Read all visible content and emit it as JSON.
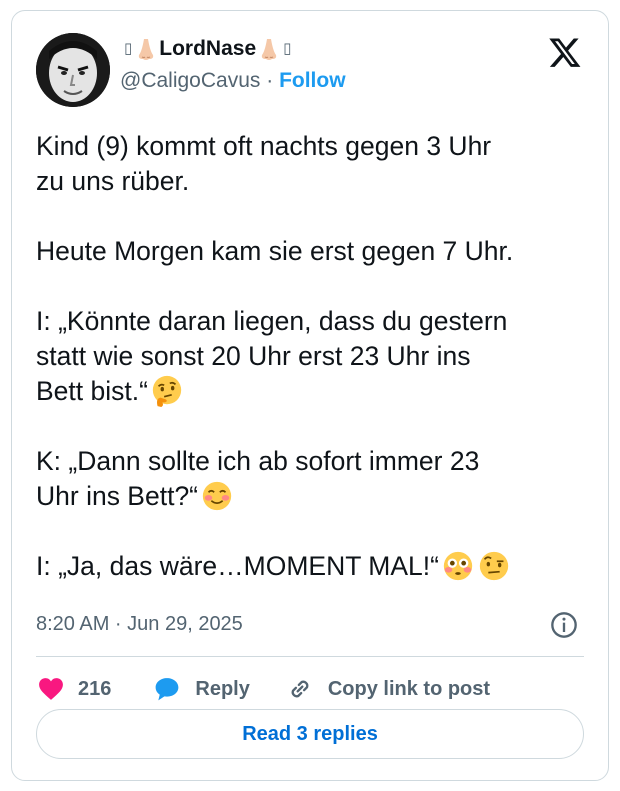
{
  "author": {
    "name_prefix_glyph": "▯",
    "name": "LordNase",
    "name_suffix_glyph": "▯",
    "handle": "@CaligoCavus",
    "separator": " · ",
    "follow_label": "Follow"
  },
  "post": {
    "lines": [
      "Kind (9) kommt oft nachts gegen 3 Uhr\nzu uns rüber.\n\nHeute Morgen kam sie erst gegen 7 Uhr.\n\nI: „Könnte daran liegen, dass du gestern\nstatt wie sonst 20 Uhr erst 23 Uhr ins\nBett bist.“",
      "\n\nK: „Dann sollte ich ab sofort immer 23\nUhr ins Bett?“",
      "\n\nI: „Ja, das wäre…MOMENT MAL!“"
    ],
    "emojis": [
      "thinking-face",
      "smiling-face-blushing",
      "flushed-face",
      "face-raised-eyebrow"
    ],
    "timestamp": "8:20 AM · Jun 29, 2025"
  },
  "actions": {
    "likes": "216",
    "reply_label": "Reply",
    "copy_label": "Copy link to post"
  },
  "read_replies_label": "Read 3 replies",
  "colors": {
    "like": "#f91880",
    "reply": "#1d9bf0",
    "follow": "#1d9bf0",
    "border": "#cfd9de",
    "secondary_text": "#536471"
  }
}
